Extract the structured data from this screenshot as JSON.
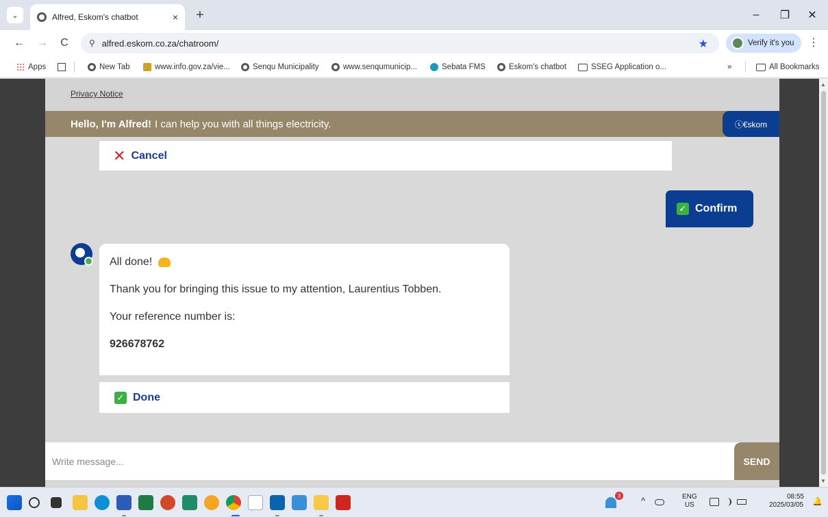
{
  "browser": {
    "tab_title": "Alfred, Eskom's chatbot",
    "tab_close": "×",
    "new_tab": "+",
    "tab_menu": "⌄",
    "url": "alfred.eskom.co.za/chatroom/",
    "verify_label": "Verify it's you",
    "window_controls": {
      "minimize": "–",
      "restore": "❐",
      "close": "✕"
    },
    "nav": {
      "back": "←",
      "forward": "→",
      "reload": "C",
      "site_info": "⚲",
      "star": "★",
      "menu": "⋮"
    }
  },
  "bookmarks": {
    "apps": "Apps",
    "items": [
      "New Tab",
      "www.info.gov.za/vie...",
      "Senqu Municipality",
      "www.senqumunicip...",
      "Sebata FMS",
      "Eskom's chatbot",
      "SSEG Application o..."
    ],
    "overflow": "»",
    "all_bookmarks": "All Bookmarks"
  },
  "chat": {
    "privacy_notice": "Privacy Notice",
    "banner_bold": "Hello, I'm Alfred!",
    "banner_text": "I can help you with all things electricity.",
    "logo_text": "ⓢ€skom",
    "cancel_icon": "✕",
    "cancel_label": "Cancel",
    "confirm_label": "Confirm",
    "check_icon": "✓",
    "messages": {
      "line1": "All done!",
      "line2": "Thank you for bringing this issue to my attention, Laurentius Tobben.",
      "line3": "Your reference number is:",
      "reference": "926678762"
    },
    "done_label": "Done",
    "input_placeholder": "Write message...",
    "send_label": "SEND"
  },
  "scrollbar": {
    "up": "▲",
    "down": "▼"
  },
  "taskbar": {
    "notification_count": "3",
    "lang_line1": "ENG",
    "lang_line2": "US",
    "time": "08:55",
    "date": "2025/03/05",
    "chevron": "^",
    "bell": "🔔"
  },
  "colors": {
    "banner": "#96866a",
    "eskom_blue": "#0b3d91",
    "cancel_red": "#d92020",
    "check_green": "#3cb043"
  }
}
